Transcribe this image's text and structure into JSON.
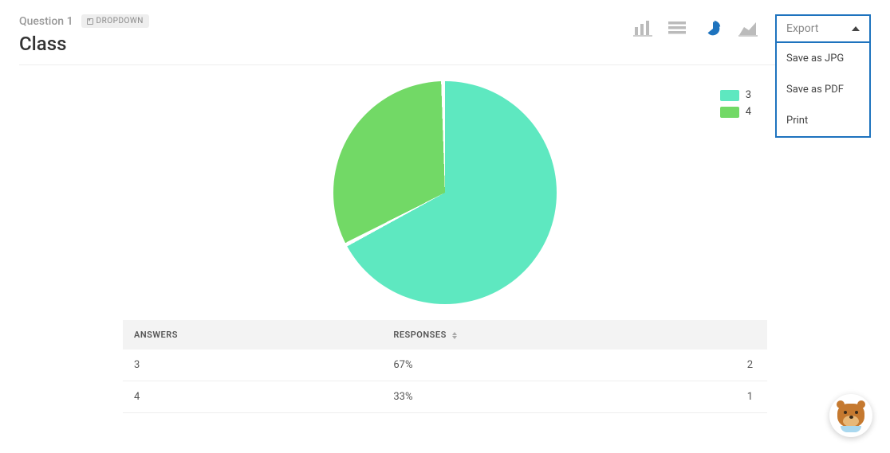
{
  "header": {
    "question_label": "Question 1",
    "badge": "DROPDOWN",
    "title": "Class"
  },
  "chart_types": {
    "bar": "bar-chart-icon",
    "hbar": "hbar-chart-icon",
    "pie": "pie-chart-icon",
    "area": "area-chart-icon",
    "active": "pie"
  },
  "export": {
    "label": "Export",
    "items": [
      "Save as JPG",
      "Save as PDF",
      "Print"
    ]
  },
  "legend": [
    {
      "label": "3",
      "color": "#5ee8c0"
    },
    {
      "label": "4",
      "color": "#72d966"
    }
  ],
  "table": {
    "col_answers": "ANSWERS",
    "col_responses": "RESPONSES",
    "rows": [
      {
        "answer": "3",
        "pct": "67%",
        "count": "2"
      },
      {
        "answer": "4",
        "pct": "33%",
        "count": "1"
      }
    ]
  },
  "chart_data": {
    "type": "pie",
    "title": "Class",
    "series": [
      {
        "name": "3",
        "value": 67,
        "count": 2,
        "color": "#5ee8c0"
      },
      {
        "name": "4",
        "value": 33,
        "count": 1,
        "color": "#72d966"
      }
    ],
    "unit": "percent"
  }
}
